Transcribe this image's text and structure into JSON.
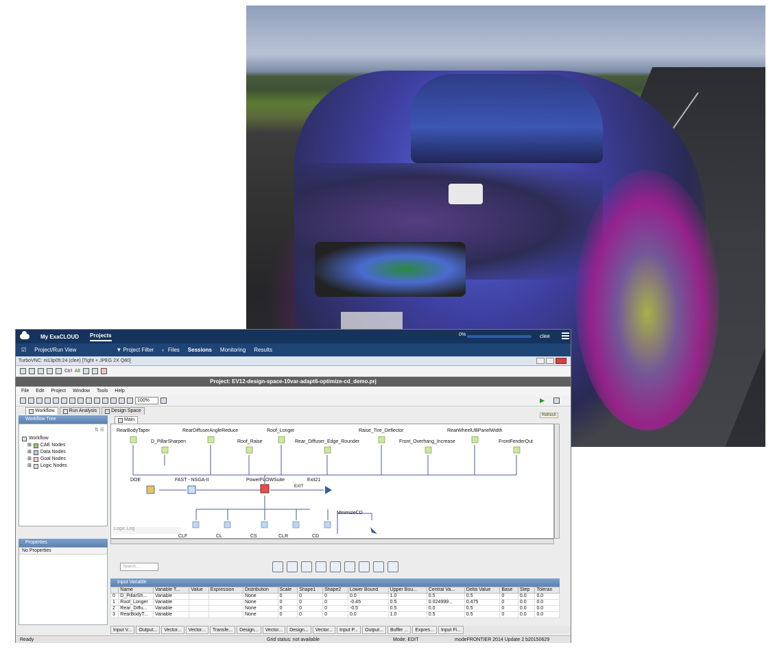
{
  "app": {
    "brand": "My ExaCLOUD",
    "nav_projects": "Projects",
    "progress_pct": "0%",
    "progress_value": 0,
    "user": "clee"
  },
  "subnav": {
    "project_run_view": "Project/Run View",
    "project_filter": "Project Filter",
    "files": "Files",
    "sessions": "Sessions",
    "monitoring": "Monitoring",
    "results": "Results"
  },
  "vnc": {
    "title": "TurboVNC: ni13p05:24 (clee) [Tight + JPEG 2X Q80]",
    "ctrl": "Ctrl",
    "alt": "Alt"
  },
  "project": {
    "title": "Project: EV12-design-space-10var-adapt6-optimize-cd_demo.prj"
  },
  "menu": [
    "File",
    "Edit",
    "Project",
    "Window",
    "Tools",
    "Help"
  ],
  "toolbar": {
    "zoom": "100%",
    "refresh_tip": "Refresh"
  },
  "top_tabs": [
    "Workflow",
    "Run Analysis",
    "Design Space"
  ],
  "workflow_tree": {
    "title": "Workflow Tree",
    "root": "Workflow",
    "children": [
      "CAE Nodes",
      "Data Nodes",
      "Goal Nodes",
      "Logic Nodes"
    ]
  },
  "properties": {
    "title": "Properties",
    "empty": "No Properties"
  },
  "canvas": {
    "tab": "Main",
    "top_vars": [
      "RearBodyTaper",
      "RearDiffuserAngleReduce",
      "Roof_Longer",
      "Raise_Tire_Deflector",
      "RearWheelUBPanelWidth"
    ],
    "mid_vars": [
      "D_PillarSharpen",
      "Roof_Raise",
      "Rear_Diffuser_Edge_Rounder",
      "Front_Overhang_Increase",
      "FrontFenderOut"
    ],
    "flow": {
      "doe": "DOE",
      "nsga": "FAST - NSGA-II",
      "suite": "PowerFLOWSuite",
      "exit": "Exit21",
      "exit_label": "EXIT",
      "min": "MinimizeCD"
    },
    "outputs": [
      "CLF",
      "CL",
      "CS",
      "CLR",
      "CD"
    ],
    "logic_log": "Logic Log"
  },
  "search": {
    "placeholder": "Search..."
  },
  "input_variable": {
    "title": "Input Variable",
    "columns": [
      "",
      "Name",
      "Variable T...",
      "Value",
      "Expression",
      "Distribution",
      "Scale",
      "Shape1",
      "Shape2",
      "Lower Bound",
      "Upper Bou...",
      "Central Va...",
      "Delta Value",
      "Base",
      "Step",
      "Toleran"
    ],
    "rows": [
      [
        "0",
        "D_PillarSh...",
        "Variable",
        "",
        "",
        "None",
        "0",
        "0",
        "0",
        "0.0",
        "1.0",
        "0.5",
        "0.5",
        "0",
        "0.0",
        "0.0"
      ],
      [
        "1",
        "Roof_Longer",
        "Variable",
        "",
        "",
        "None",
        "0",
        "0",
        "0",
        "-0.45",
        "0.5",
        "0.024999...",
        "0.475",
        "0",
        "0.0",
        "0.0"
      ],
      [
        "2",
        "Rear_Diffu...",
        "Variable",
        "",
        "",
        "None",
        "0",
        "0",
        "0",
        "-0.5",
        "0.5",
        "0.0",
        "0.5",
        "0",
        "0.0",
        "0.0"
      ],
      [
        "3",
        "RearBodyT...",
        "Variable",
        "",
        "",
        "None",
        "0",
        "0",
        "0",
        "0.0",
        "1.0",
        "0.5",
        "0.5",
        "0",
        "0.0",
        "0.0"
      ]
    ]
  },
  "bottom_tabs": [
    "Input V...",
    "Output...",
    "Vector...",
    "Vector...",
    "Transfe...",
    "Design...",
    "Vector...",
    "Design...",
    "Vector...",
    "Input P...",
    "Output...",
    "Buffer ...",
    "Expres...",
    "Input Fi..."
  ],
  "status": {
    "ready": "Ready",
    "grid": "Grid status: not available",
    "mode": "Mode: EDIT",
    "version": "modeFRONTIER 2014 Update 2 b20150629"
  }
}
